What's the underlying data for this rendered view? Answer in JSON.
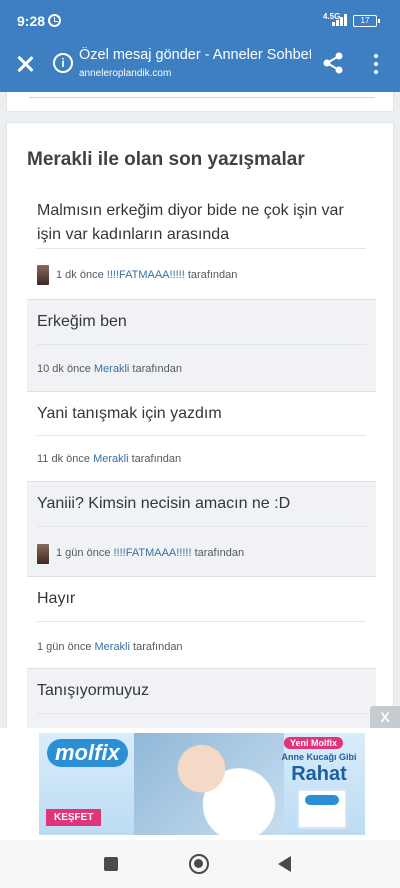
{
  "status_bar": {
    "time": "9:28",
    "network": "4.5G",
    "battery": "17"
  },
  "app_bar": {
    "title": "Özel mesaj gönder - Anneler Sohbet",
    "url": "anneleroplandik.com"
  },
  "conversation": {
    "heading": "Merakli ile olan son yazışmalar",
    "messages": [
      {
        "text": "Malmısın erkeğim diyor bide ne çok işin var işin var kadınların arasında",
        "time": "1 dk önce",
        "author": "!!!!FATMAAA!!!!!",
        "suffix": "tarafından",
        "has_avatar": true
      },
      {
        "text": "Erkeğim ben",
        "time": "10 dk önce",
        "author": "Merakli",
        "suffix": "tarafından",
        "has_avatar": false
      },
      {
        "text": "Yani tanışmak için yazdım",
        "time": "11 dk önce",
        "author": "Merakli",
        "suffix": "tarafından",
        "has_avatar": false
      },
      {
        "text": "Yaniii? Kimsin necisin amacın ne :D",
        "time": "1 gün önce",
        "author": "!!!!FATMAAA!!!!!",
        "suffix": "tarafından",
        "has_avatar": true
      },
      {
        "text": "Hayır",
        "time": "1 gün önce",
        "author": "Merakli",
        "suffix": "tarafından",
        "has_avatar": false
      },
      {
        "text": "Tanışıyormuyuz",
        "time": "",
        "author": "",
        "suffix": "",
        "has_avatar": false
      }
    ]
  },
  "ad": {
    "close_label": "X",
    "brand": "molfix",
    "badge": "Yeni Molfix",
    "tagline": "Anne Kucağı Gibi",
    "headline": "Rahat",
    "cta": "KEŞFET"
  },
  "colors": {
    "header_blue": "#3d7fc1",
    "link_blue": "#3870a8",
    "ad_pink": "#e0347c"
  },
  "icons": {
    "close": "close-icon",
    "info": "info-icon",
    "share": "share-icon",
    "more": "more-vert-icon",
    "alarm": "alarm-icon",
    "signal": "signal-icon",
    "battery": "battery-icon"
  }
}
